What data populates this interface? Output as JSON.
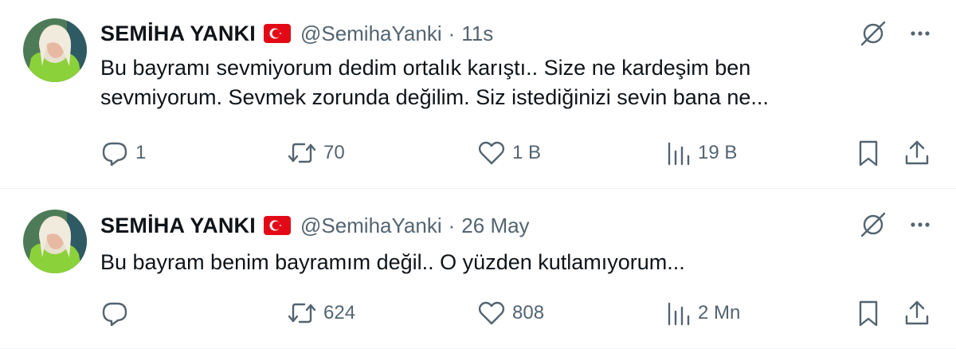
{
  "tweets": [
    {
      "name": "SEMİHA YANKI",
      "handle": "@SemihaYanki",
      "separator": "·",
      "time": "11s",
      "text_lines": [
        "Bu bayramı sevmiyorum dedim ortalık karıştı.. Size ne kardeşim ben",
        "sevmiyorum. Sevmek zorunda değilim. Siz istediğinizi sevin bana ne..."
      ],
      "replies": "1",
      "retweets": "70",
      "likes": "1 B",
      "views": "19 B"
    },
    {
      "name": "SEMİHA YANKI",
      "handle": "@SemihaYanki",
      "separator": "·",
      "time": "26 May",
      "text_lines": [
        "Bu bayram benim bayramım değil.. O yüzden kutlamıyorum..."
      ],
      "replies": "",
      "retweets": "624",
      "likes": "808",
      "views": "2 Mn"
    }
  ],
  "icons": {
    "flag": "turkey-flag-icon",
    "grok": "grok-slash-icon",
    "more": "more-dots-icon",
    "reply": "reply-icon",
    "retweet": "retweet-icon",
    "like": "heart-icon",
    "views": "views-chart-icon",
    "bookmark": "bookmark-icon",
    "share": "share-icon"
  },
  "colors": {
    "text": "#0f1419",
    "secondary": "#536471",
    "flag_red": "#e30a17",
    "divider": "#eff3f4"
  }
}
